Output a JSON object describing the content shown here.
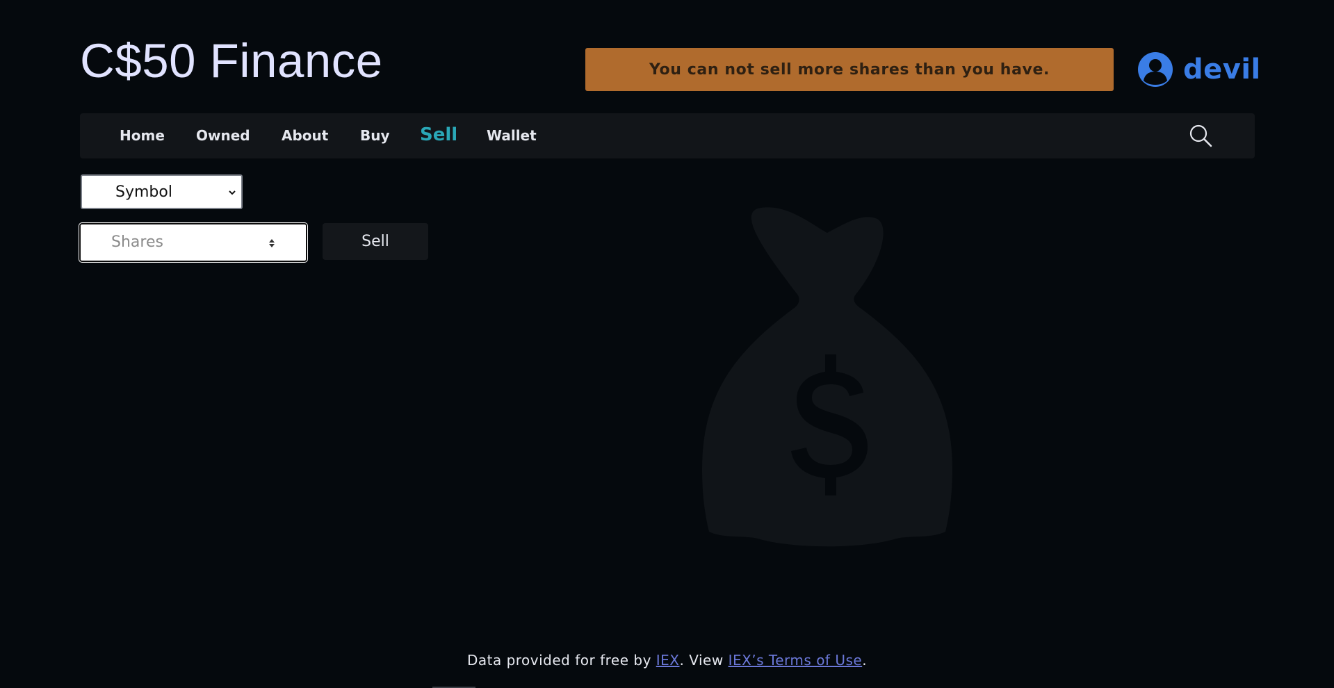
{
  "header": {
    "brand": "C$50 Finance",
    "alert": "You can not sell more shares than you have.",
    "user": {
      "name": "devil",
      "icon": "user-circle-icon"
    }
  },
  "nav": {
    "items": [
      {
        "label": "Home",
        "active": false
      },
      {
        "label": "Owned",
        "active": false
      },
      {
        "label": "About",
        "active": false
      },
      {
        "label": "Buy",
        "active": false
      },
      {
        "label": "Sell",
        "active": true
      },
      {
        "label": "Wallet",
        "active": false
      }
    ],
    "search_icon": "search-icon"
  },
  "form": {
    "symbol_selected": "Symbol",
    "shares_placeholder": "Shares",
    "submit_label": "Sell"
  },
  "background_icon": "money-bag-icon",
  "footer": {
    "prefix": "Data provided for free by ",
    "iex_link": "IEX",
    "middle": ". View ",
    "terms_link": "IEX’s Terms of Use",
    "suffix": "."
  },
  "colors": {
    "background": "#05090d",
    "alert_bg": "#b06b2d",
    "accent_blue": "#3a7de6",
    "active_nav": "#2aa8b8",
    "link": "#6b78d8"
  }
}
